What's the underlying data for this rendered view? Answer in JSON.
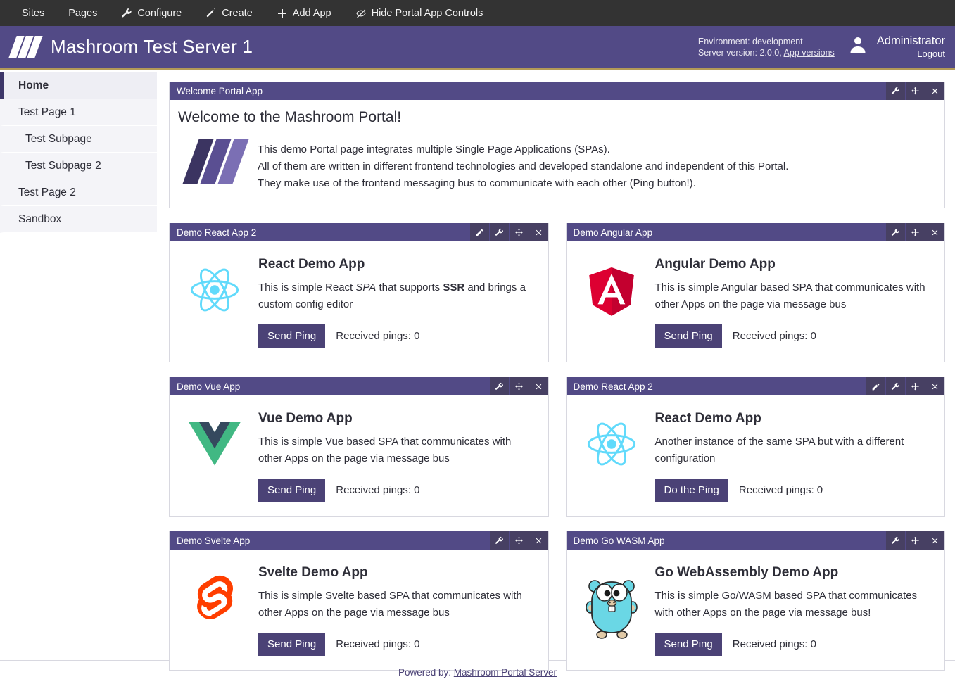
{
  "toolbar": {
    "items": [
      {
        "label": "Sites",
        "icon": "none"
      },
      {
        "label": "Pages",
        "icon": "none"
      },
      {
        "label": "Configure",
        "icon": "wrench-icon"
      },
      {
        "label": "Create",
        "icon": "magic-wand-icon"
      },
      {
        "label": "Add App",
        "icon": "plus-icon"
      },
      {
        "label": "Hide Portal App Controls",
        "icon": "eye-slash-icon"
      }
    ]
  },
  "header": {
    "title": "Mashroom Test Server 1",
    "logo_icon": "mashroom-logo-icon",
    "environment_line": "Environment: development",
    "version_prefix": "Server version: 2.0.0,",
    "app_versions_link": "App versions",
    "avatar_icon": "user-avatar-icon",
    "user_name": "Administrator",
    "logout_label": "Logout",
    "accent_color": "#b39a57",
    "brand_color": "#524a86"
  },
  "sidebar": {
    "items": [
      {
        "label": "Home",
        "level": 1,
        "active": true
      },
      {
        "label": "Test Page 1",
        "level": 1,
        "active": false
      },
      {
        "label": "Test Subpage",
        "level": 2,
        "active": false
      },
      {
        "label": "Test Subpage 2",
        "level": 2,
        "active": false
      },
      {
        "label": "Test Page 2",
        "level": 1,
        "active": false
      },
      {
        "label": "Sandbox",
        "level": 1,
        "active": false
      }
    ]
  },
  "welcome_app": {
    "window_title": "Welcome Portal App",
    "heading": "Welcome to the Mashroom Portal!",
    "lines": [
      "This demo Portal page integrates multiple Single Page Applications (SPAs).",
      "All of them are written in different frontend technologies and developed standalone and independent of this Portal.",
      "They make use of the frontend messaging bus to communicate with each other (Ping button!)."
    ],
    "controls": [
      "wrench-icon",
      "move-icon",
      "close-icon"
    ]
  },
  "apps": [
    {
      "window_title": "Demo React App 2",
      "controls": [
        "pencil-icon",
        "wrench-icon",
        "move-icon",
        "close-icon"
      ],
      "logo": "react-logo-icon",
      "title": "React Demo App",
      "desc_html": "This is simple React <i>SPA</i> that supports <b>SSR</b> and brings a custom config editor",
      "button_label": "Send Ping",
      "ping_label": "Received pings: 0"
    },
    {
      "window_title": "Demo Angular App",
      "controls": [
        "wrench-icon",
        "move-icon",
        "close-icon"
      ],
      "logo": "angular-logo-icon",
      "title": "Angular Demo App",
      "desc_html": "This is simple Angular based SPA that communicates with other Apps on the page via message bus",
      "button_label": "Send Ping",
      "ping_label": "Received pings: 0"
    },
    {
      "window_title": "Demo Vue App",
      "controls": [
        "wrench-icon",
        "move-icon",
        "close-icon"
      ],
      "logo": "vue-logo-icon",
      "title": "Vue Demo App",
      "desc_html": "This is simple Vue based SPA that communicates with other Apps on the page via message bus",
      "button_label": "Send Ping",
      "ping_label": "Received pings: 0"
    },
    {
      "window_title": "Demo React App 2",
      "controls": [
        "pencil-icon",
        "wrench-icon",
        "move-icon",
        "close-icon"
      ],
      "logo": "react-logo-icon",
      "title": "React Demo App",
      "desc_html": "Another instance of the same SPA but with a different configuration",
      "button_label": "Do the Ping",
      "ping_label": "Received pings: 0"
    },
    {
      "window_title": "Demo Svelte App",
      "controls": [
        "wrench-icon",
        "move-icon",
        "close-icon"
      ],
      "logo": "svelte-logo-icon",
      "title": "Svelte Demo App",
      "desc_html": "This is simple Svelte based SPA that communicates with other Apps on the page via message bus",
      "button_label": "Send Ping",
      "ping_label": "Received pings: 0"
    },
    {
      "window_title": "Demo Go WASM App",
      "controls": [
        "wrench-icon",
        "move-icon",
        "close-icon"
      ],
      "logo": "go-gopher-logo-icon",
      "title": "Go WebAssembly Demo App",
      "desc_html": "This is simple Go/WASM based SPA that communicates with other Apps on the page via message bus!",
      "button_label": "Send Ping",
      "ping_label": "Received pings: 0"
    }
  ],
  "footer": {
    "prefix": "Powered by:",
    "link_label": "Mashroom Portal Server"
  }
}
